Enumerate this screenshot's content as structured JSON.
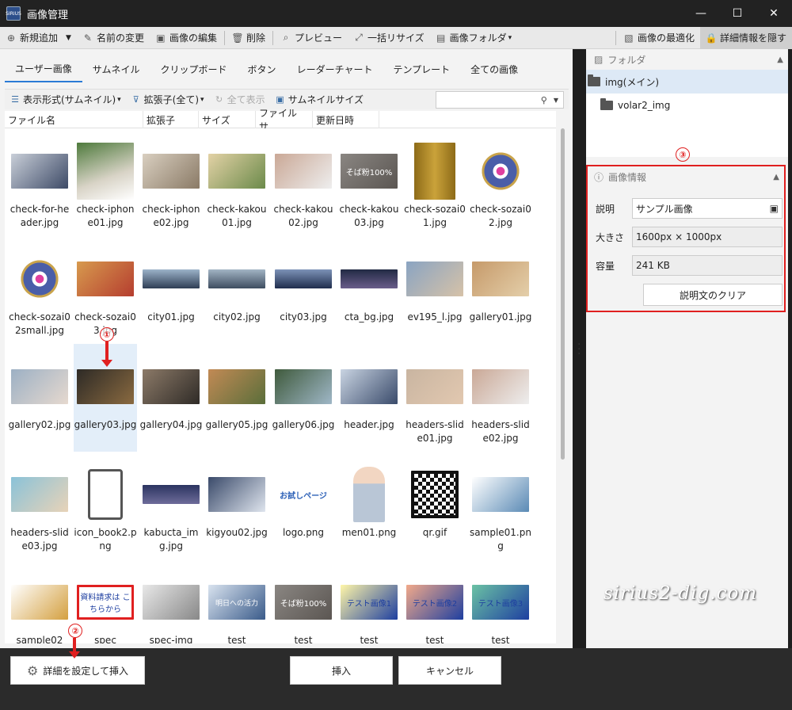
{
  "window": {
    "title": "画像管理",
    "app_icon_text": "SIRIUS",
    "min": "—",
    "max": "☐",
    "close": "✕"
  },
  "toolbar": {
    "new_add": "新規追加",
    "rename": "名前の変更",
    "edit": "画像の編集",
    "delete": "削除",
    "preview": "プレビュー",
    "resize": "一括リサイズ",
    "folder": "画像フォルダ",
    "optimize": "画像の最適化",
    "hide_detail": "詳細情報を隠す"
  },
  "tabs": [
    "ユーザー画像",
    "サムネイル",
    "クリップボード",
    "ボタン",
    "レーダーチャート",
    "テンプレート",
    "全ての画像"
  ],
  "subtoolbar": {
    "view": "表示形式(サムネイル)",
    "ext": "拡張子(全て)",
    "show_all": "全て表示",
    "thumb_size": "サムネイルサイズ",
    "search_placeholder": ""
  },
  "columns": [
    "ファイル名",
    "拡張子",
    "サイズ",
    "ファイルサ...",
    "更新日時"
  ],
  "files": [
    {
      "cap": "check-for-header.jpg",
      "c": "#c9cfd9",
      "c2": "#3d4a66",
      "shape": "wide"
    },
    {
      "cap": "check-iphone01.jpg",
      "c": "#d8d3c6",
      "c2": "#4e7a3c",
      "shape": "sq"
    },
    {
      "cap": "check-iphone02.jpg",
      "c": "#d9cfc0",
      "c2": "#8a7a66",
      "shape": "wide"
    },
    {
      "cap": "check-kakou01.jpg",
      "c": "#e3d2a6",
      "c2": "#6b8a4a",
      "shape": "wide"
    },
    {
      "cap": "check-kakou02.jpg",
      "c": "#caa896",
      "c2": "#eee",
      "shape": "wide"
    },
    {
      "cap": "check-kakou03.jpg",
      "c": "#8a8682",
      "c2": "#5b5652",
      "shape": "wide"
    },
    {
      "cap": "check-sozai01.jpg",
      "c": "#caa23a",
      "c2": "#8d6b18",
      "shape": "tall"
    },
    {
      "cap": "check-sozai02.jpg",
      "c": "#4a5ea8",
      "c2": "#c9a34a",
      "shape": "flower"
    },
    {
      "cap": "check-sozai02small.jpg",
      "c": "#4a5ea8",
      "c2": "#c9a34a",
      "shape": "flower"
    },
    {
      "cap": "check-sozai03.jpg",
      "c": "#d79a4e",
      "c2": "#b53d2f",
      "shape": "wide"
    },
    {
      "cap": "city01.jpg",
      "c": "#9cb3c9",
      "c2": "#2f3e55",
      "shape": "strip"
    },
    {
      "cap": "city02.jpg",
      "c": "#a2b4c4",
      "c2": "#3e4d60",
      "shape": "strip"
    },
    {
      "cap": "city03.jpg",
      "c": "#7d93b8",
      "c2": "#1f2d4d",
      "shape": "strip"
    },
    {
      "cap": "cta_bg.jpg",
      "c": "#222a44",
      "c2": "#6a5d8a",
      "shape": "strip"
    },
    {
      "cap": "ev195_l.jpg",
      "c": "#8aa4c2",
      "c2": "#d6c2a8",
      "shape": "wide"
    },
    {
      "cap": "gallery01.jpg",
      "c": "#c69a6a",
      "c2": "#e4cfaa",
      "shape": "wide"
    },
    {
      "cap": "gallery02.jpg",
      "c": "#9cb0c4",
      "c2": "#e6d9cf",
      "shape": "wide"
    },
    {
      "cap": "gallery03.jpg",
      "c": "#2d2a26",
      "c2": "#8a6a40",
      "shape": "wide"
    },
    {
      "cap": "gallery04.jpg",
      "c": "#8c7a68",
      "c2": "#2f2b27",
      "shape": "wide"
    },
    {
      "cap": "gallery05.jpg",
      "c": "#c28a55",
      "c2": "#5a6e3a",
      "shape": "wide"
    },
    {
      "cap": "gallery06.jpg",
      "c": "#3f5a3c",
      "c2": "#9fb7c7",
      "shape": "wide"
    },
    {
      "cap": "header.jpg",
      "c": "#c9d4e2",
      "c2": "#3a4b6b",
      "shape": "wide"
    },
    {
      "cap": "headers-slide01.jpg",
      "c": "#c9b5a1",
      "c2": "#e2c8b0",
      "shape": "wide"
    },
    {
      "cap": "headers-slide02.jpg",
      "c": "#caa896",
      "c2": "#eee",
      "shape": "wide"
    },
    {
      "cap": "headers-slide03.jpg",
      "c": "#8ac2d8",
      "c2": "#e8d3b8",
      "shape": "wide"
    },
    {
      "cap": "icon_book2.png",
      "c": "#ffffff",
      "c2": "#555",
      "shape": "book"
    },
    {
      "cap": "kabucta_img.jpg",
      "c": "#2b3460",
      "c2": "#6e6c9a",
      "shape": "strip"
    },
    {
      "cap": "kigyou02.jpg",
      "c": "#3a4a6a",
      "c2": "#dfe5ee",
      "shape": "wide"
    },
    {
      "cap": "logo.png",
      "c": "#ffffff",
      "c2": "#2e62b8",
      "shape": "logo"
    },
    {
      "cap": "men01.png",
      "c": "#ffffff",
      "c2": "#b9c6d6",
      "shape": "man"
    },
    {
      "cap": "qr.gif",
      "c": "#ffffff",
      "c2": "#111",
      "shape": "qr"
    },
    {
      "cap": "sample01.png",
      "c": "#ffffff",
      "c2": "#5a8ab5",
      "shape": "wide"
    },
    {
      "cap": "sample02",
      "c": "#ffffff",
      "c2": "#d4a040",
      "shape": "wide"
    },
    {
      "cap": "spec",
      "c": "#ffffff",
      "c2": "#e02020",
      "shape": "wide"
    },
    {
      "cap": "spec-img",
      "c": "#e8e8e8",
      "c2": "#888",
      "shape": "wide"
    },
    {
      "cap": "test",
      "c": "#d9e3ef",
      "c2": "#3a5b8a",
      "shape": "wide"
    },
    {
      "cap": "test",
      "c": "#8a8682",
      "c2": "#5b5652",
      "shape": "wide"
    },
    {
      "cap": "test",
      "c": "#fff6a8",
      "c2": "#1e3fa0",
      "shape": "wide"
    },
    {
      "cap": "test",
      "c": "#f2a98a",
      "c2": "#1e3fa0",
      "shape": "wide"
    },
    {
      "cap": "test",
      "c": "#6bc2a4",
      "c2": "#1e3fa0",
      "shape": "wide"
    }
  ],
  "overlay_texts": {
    "kakou03": "そば粉100%",
    "book": "",
    "logo": "お試しページ",
    "spec": "資料請求は こちらから",
    "test1": "テスト画像1",
    "test2": "テスト画像2",
    "test3": "テスト画像3",
    "test_a": "明日への活力"
  },
  "right_panel": {
    "folder_header": "フォルダ",
    "folders": [
      "img(メイン)",
      "volar2_img"
    ],
    "info_header": "画像情報",
    "desc_label": "説明",
    "desc_value": "サンプル画像",
    "size_label": "大きさ",
    "size_value": "1600px × 1000px",
    "capacity_label": "容量",
    "capacity_value": "241 KB",
    "clear_button": "説明文のクリア"
  },
  "bottom": {
    "detail_insert": "詳細を設定して挿入",
    "insert": "挿入",
    "cancel": "キャンセル"
  },
  "annotations": {
    "c1": "①",
    "c2": "②",
    "c3": "③"
  },
  "watermark": "sirius2-dig.com",
  "colors": {
    "accent": "#2b7bd6",
    "annotation_red": "#e02020",
    "selected": "#e3eef9"
  }
}
